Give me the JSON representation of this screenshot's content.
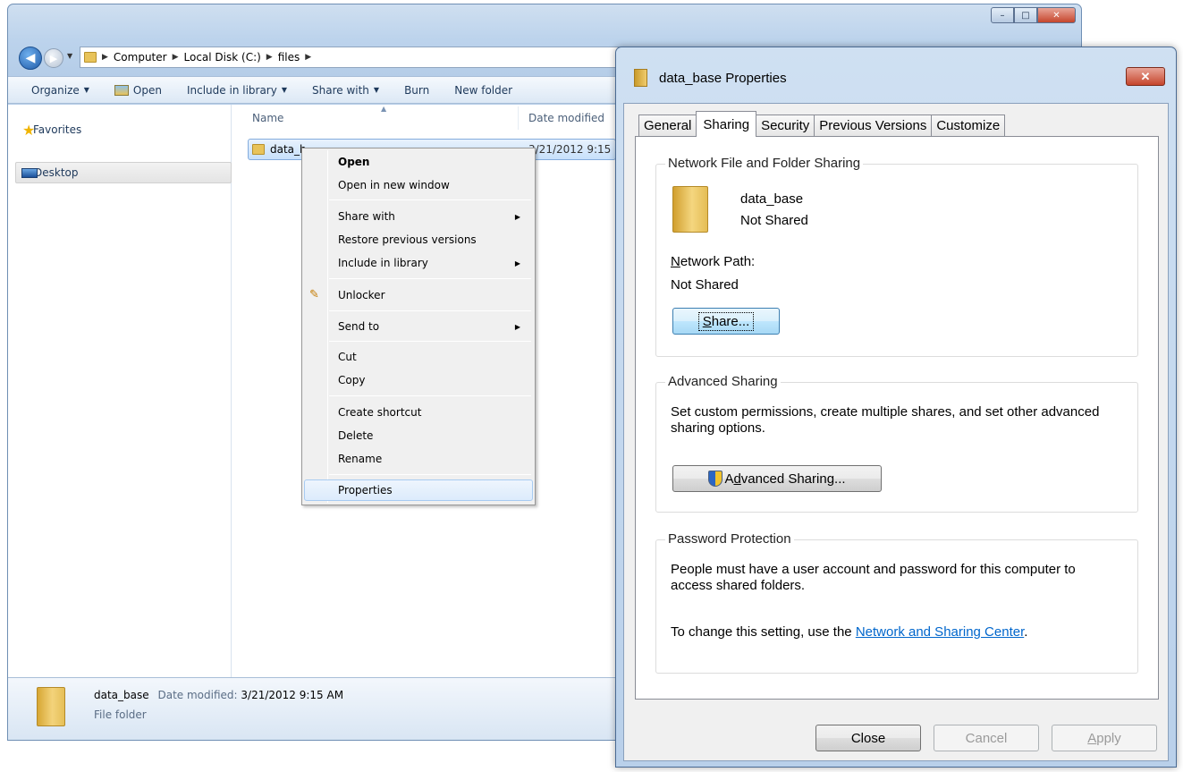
{
  "explorer": {
    "window_controls": {
      "minimize": "–",
      "maximize": "□",
      "close": "✕"
    },
    "nav": {
      "back": "◀",
      "forward": "▶",
      "recent": "▼"
    },
    "breadcrumb": [
      "Computer",
      "Local Disk (C:)",
      "files"
    ],
    "crumb_sep": "▶",
    "toolbar": {
      "organize": "Organize",
      "open": "Open",
      "include_in_library": "Include in library",
      "share_with": "Share with",
      "burn": "Burn",
      "new_folder": "New folder",
      "arrow": "▼"
    },
    "nav_pane": {
      "favorites": "Favorites",
      "desktop": "Desktop",
      "star": "★"
    },
    "columns": {
      "name": "Name",
      "date_modified": "Date modified",
      "sort_caret": "▲"
    },
    "file_row": {
      "name": "data_b",
      "date": "3/21/2012 9:15 A"
    },
    "details": {
      "name": "data_base",
      "date_label": "Date modified:",
      "date_value": "3/21/2012 9:15 AM",
      "type": "File folder"
    }
  },
  "context_menu": {
    "open": "Open",
    "open_new_window": "Open in new window",
    "share_with": "Share with",
    "restore_previous": "Restore previous versions",
    "include_in_library": "Include in library",
    "unlocker": "Unlocker",
    "send_to": "Send to",
    "cut": "Cut",
    "copy": "Copy",
    "create_shortcut": "Create shortcut",
    "delete": "Delete",
    "rename": "Rename",
    "properties": "Properties",
    "submenu_arrow": "▶",
    "wand": "✎"
  },
  "dialog": {
    "title": "data_base Properties",
    "close": "✕",
    "tabs": [
      "General",
      "Sharing",
      "Security",
      "Previous Versions",
      "Customize"
    ],
    "active_tab": "Sharing",
    "network_sharing": {
      "title": "Network File and Folder Sharing",
      "folder_name": "data_base",
      "status": "Not Shared",
      "path_label_ak": "N",
      "path_label_rest": "etwork Path:",
      "path_value": "Not Shared",
      "share_button_ak": "S",
      "share_button_rest": "hare..."
    },
    "advanced_sharing": {
      "title": "Advanced Sharing",
      "description": "Set custom permissions, create multiple shares, and set other advanced sharing options.",
      "button_pre": "A",
      "button_ak": "d",
      "button_rest": "vanced Sharing..."
    },
    "password_protection": {
      "title": "Password Protection",
      "description": "People must have a user account and password for this computer to access shared folders.",
      "change_prefix": "To change this setting, use the ",
      "link": "Network and Sharing Center",
      "change_suffix": "."
    },
    "buttons": {
      "close": "Close",
      "cancel": "Cancel",
      "apply_ak": "A",
      "apply_rest": "pply"
    }
  }
}
